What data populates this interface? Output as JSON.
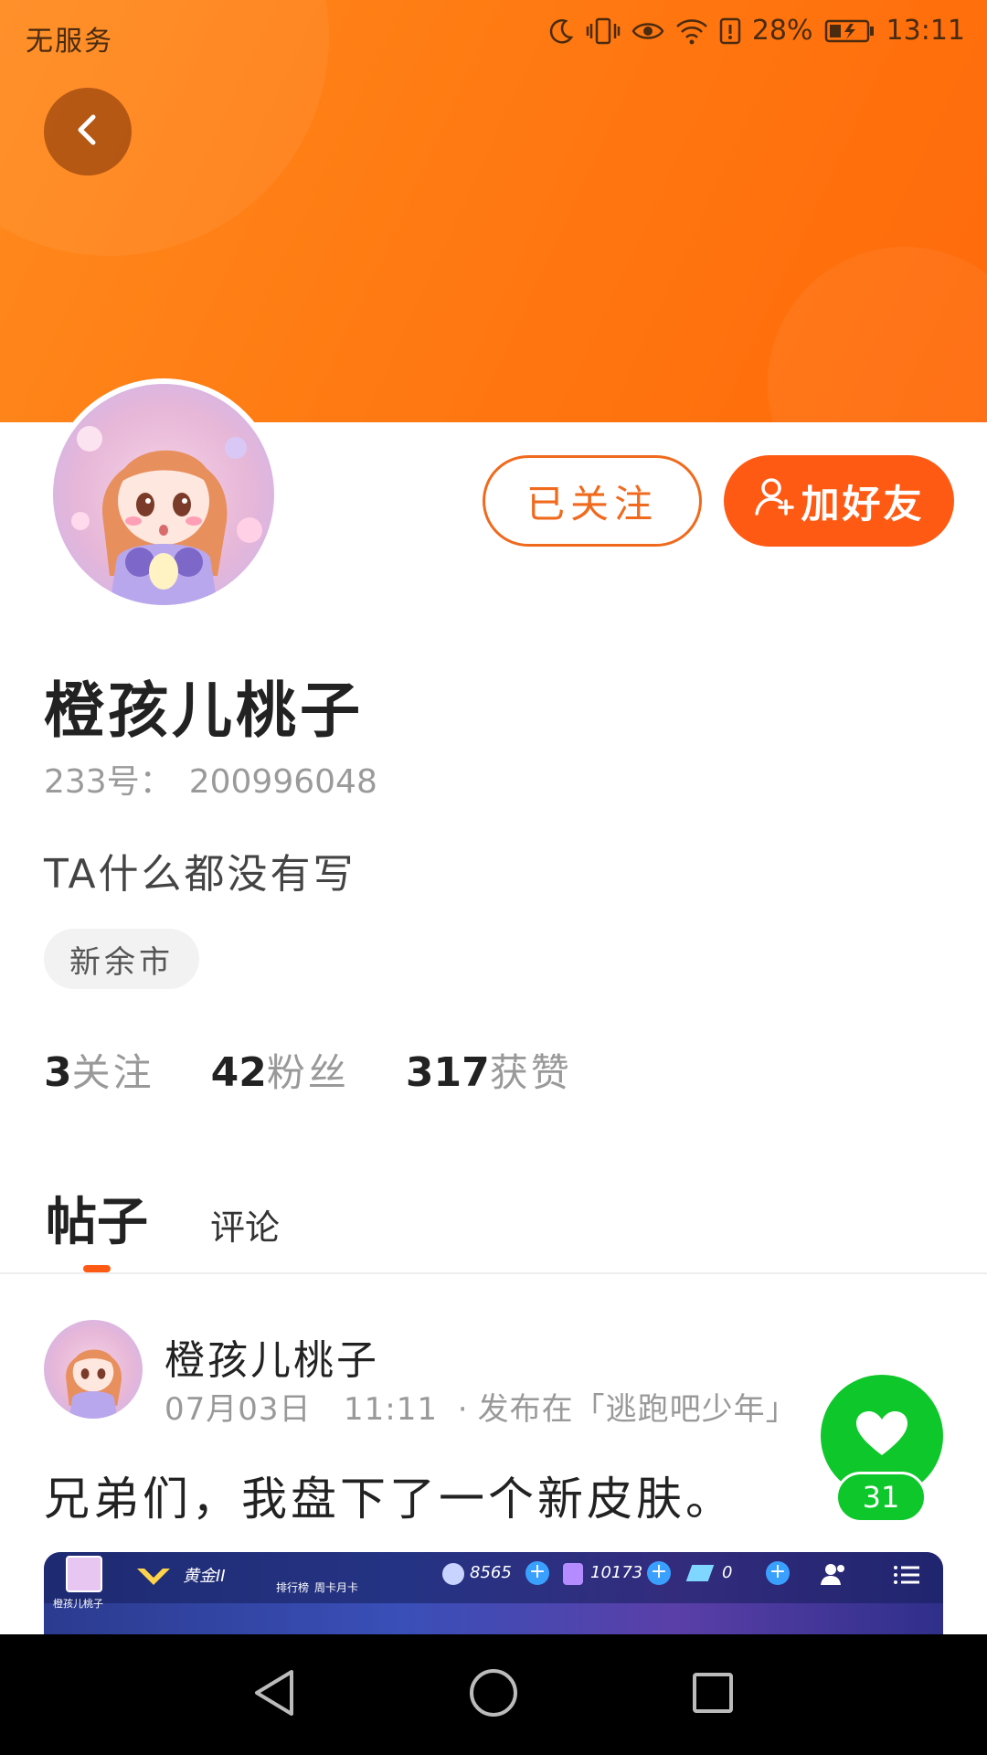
{
  "status_bar": {
    "carrier": "无服务",
    "battery_percent": "28%",
    "time": "13:11",
    "icons": [
      "moon-icon",
      "vibrate-icon",
      "eye-icon",
      "wifi-icon",
      "alert-icon",
      "battery-icon"
    ]
  },
  "profile": {
    "name": "橙孩儿桃子",
    "account_label": "233号：",
    "account_id": "200996048",
    "bio": "TA什么都没有写",
    "location": "新余市",
    "follow_label": "已关注",
    "add_friend_label": "加好友"
  },
  "stats": {
    "following_count": "3",
    "following_label": "关注",
    "fans_count": "42",
    "fans_label": "粉丝",
    "likes_count": "317",
    "likes_label": "获赞"
  },
  "tabs": {
    "posts": "帖子",
    "comments": "评论"
  },
  "post": {
    "author": "橙孩儿桃子",
    "date": "07月03日",
    "time": "11:11",
    "separator": "·",
    "published_in": "发布在「逃跑吧少年」",
    "text": "兄弟们，我盘下了一个新皮肤。",
    "like_count": "31",
    "image": {
      "rank": "黄金II",
      "ranking_label": "排行榜",
      "weekly_card_label": "周卡月卡",
      "coins": "8565",
      "points": "10173",
      "diamonds": "0",
      "player_name": "橙孩儿桃子"
    }
  },
  "colors": {
    "header_orange": "#ff7a12",
    "accent_orange": "#ff5a14",
    "like_green": "#0ec72a"
  }
}
